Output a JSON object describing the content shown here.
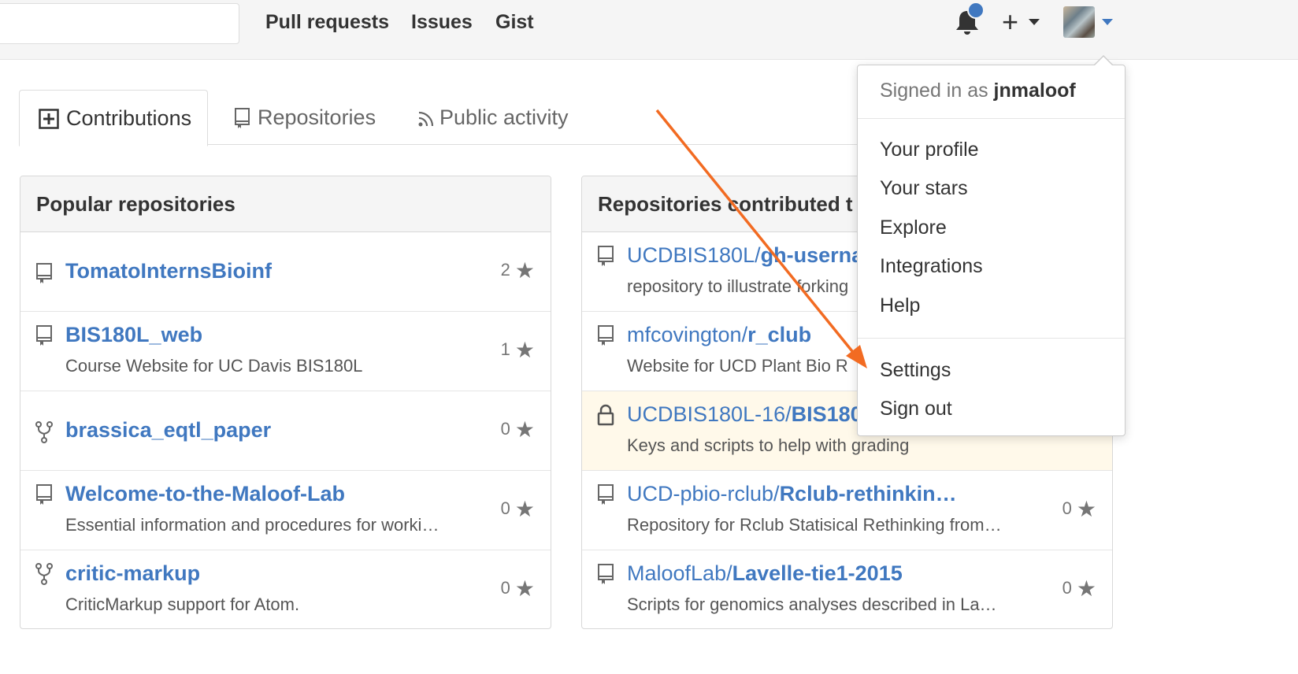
{
  "header": {
    "nav": [
      "Pull requests",
      "Issues",
      "Gist"
    ],
    "colors": {
      "accent": "#4078c0",
      "annotation_arrow": "#f26b22"
    }
  },
  "tabs": [
    {
      "label": "Contributions",
      "icon": "plus-square-icon"
    },
    {
      "label": "Repositories",
      "icon": "repo-icon"
    },
    {
      "label": "Public activity",
      "icon": "rss-icon"
    }
  ],
  "popular": {
    "title": "Popular repositories",
    "rows": [
      {
        "name": "TomatoInternsBioinf",
        "desc": "",
        "stars": "2",
        "icon": "repo-icon"
      },
      {
        "name": "BIS180L_web",
        "desc": "Course Website for UC Davis BIS180L",
        "stars": "1",
        "icon": "repo-icon"
      },
      {
        "name": "brassica_eqtl_paper",
        "desc": "",
        "stars": "0",
        "icon": "fork-icon"
      },
      {
        "name": "Welcome-to-the-Maloof-Lab",
        "desc": "Essential information and procedures for worki…",
        "stars": "0",
        "icon": "repo-icon"
      },
      {
        "name": "critic-markup",
        "desc": "CriticMarkup support for Atom.",
        "stars": "0",
        "icon": "fork-icon"
      }
    ]
  },
  "contributed": {
    "title": "Repositories contributed t",
    "rows": [
      {
        "owner": "UCDBIS180L/",
        "name": "gh-userna",
        "desc": "repository to illustrate forking",
        "stars": "",
        "icon": "repo-icon",
        "private": false
      },
      {
        "owner": "mfcovington/",
        "name": "r_club",
        "desc": "Website for UCD Plant Bio R",
        "stars": "",
        "icon": "repo-icon",
        "private": false
      },
      {
        "owner": "UCDBIS180L-16/",
        "name": "BIS180",
        "desc": "Keys and scripts to help with grading",
        "stars": "",
        "icon": "lock-icon",
        "private": true
      },
      {
        "owner": "UCD-pbio-rclub/",
        "name": "Rclub-rethinkin…",
        "desc": "Repository for Rclub Statisical Rethinking from…",
        "stars": "0",
        "icon": "repo-icon",
        "private": false
      },
      {
        "owner": "MaloofLab/",
        "name": "Lavelle-tie1-2015",
        "desc": "Scripts for genomics analyses described in La…",
        "stars": "0",
        "icon": "repo-icon",
        "private": false
      }
    ]
  },
  "dropdown": {
    "signed_prefix": "Signed in as ",
    "username": "jnmaloof",
    "items": [
      "Your profile",
      "Your stars",
      "Explore",
      "Integrations",
      "Help"
    ],
    "items2": [
      "Settings",
      "Sign out"
    ]
  }
}
